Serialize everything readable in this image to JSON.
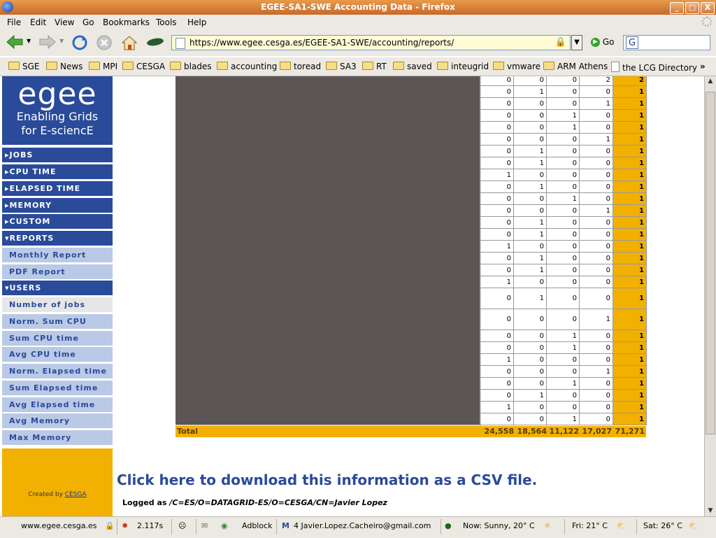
{
  "window": {
    "title": "EGEE-SA1-SWE Accounting Data - Firefox",
    "minimize": "_",
    "maximize": "□",
    "close": "X"
  },
  "menubar": {
    "items": [
      "File",
      "Edit",
      "View",
      "Go",
      "Bookmarks",
      "Tools",
      "Help"
    ]
  },
  "toolbar": {
    "url": "https://www.egee.cesga.es/EGEE-SA1-SWE/accounting/reports/",
    "go_label": "Go",
    "search_engine_glyph": "G"
  },
  "bookmarks": [
    {
      "label": "SGE",
      "type": "folder"
    },
    {
      "label": "News",
      "type": "folder"
    },
    {
      "label": "MPI",
      "type": "folder"
    },
    {
      "label": "CESGA",
      "type": "folder"
    },
    {
      "label": "blades",
      "type": "folder"
    },
    {
      "label": "accounting",
      "type": "folder"
    },
    {
      "label": "toread",
      "type": "folder"
    },
    {
      "label": "SA3",
      "type": "folder"
    },
    {
      "label": "RT",
      "type": "folder"
    },
    {
      "label": "saved",
      "type": "folder"
    },
    {
      "label": "inteugrid",
      "type": "folder"
    },
    {
      "label": "vmware",
      "type": "folder"
    },
    {
      "label": "ARM Athens",
      "type": "folder"
    },
    {
      "label": "the LCG Directory",
      "type": "page"
    }
  ],
  "bookmarks_overflow": "»",
  "logo": {
    "wordmark": "egee",
    "line1": "Enabling Grids",
    "line2": "for E-sciencE"
  },
  "sidebar": {
    "sections": [
      {
        "label": "JOBS",
        "expanded": false
      },
      {
        "label": "CPU TIME",
        "expanded": false
      },
      {
        "label": "ELAPSED TIME",
        "expanded": false
      },
      {
        "label": "MEMORY",
        "expanded": false
      },
      {
        "label": "CUSTOM",
        "expanded": false
      },
      {
        "label": "REPORTS",
        "expanded": true
      },
      {
        "label": "USERS",
        "expanded": true
      }
    ],
    "reports_items": [
      "Monthly Report",
      "PDF Report"
    ],
    "users_items": [
      "Number of jobs",
      "Norm. Sum CPU",
      "Sum CPU time",
      "Avg CPU time",
      "Norm. Elapsed time",
      "Sum Elapsed time",
      "Avg Elapsed time",
      "Avg Memory",
      "Max Memory"
    ],
    "active_item": "Number of jobs",
    "created_by": "Created by",
    "created_by_link": "CESGA"
  },
  "table": {
    "rows": [
      [
        0,
        0,
        0,
        2,
        2
      ],
      [
        0,
        1,
        0,
        0,
        1
      ],
      [
        0,
        0,
        0,
        1,
        1
      ],
      [
        0,
        0,
        1,
        0,
        1
      ],
      [
        0,
        0,
        1,
        0,
        1
      ],
      [
        0,
        0,
        0,
        1,
        1
      ],
      [
        0,
        1,
        0,
        0,
        1
      ],
      [
        0,
        1,
        0,
        0,
        1
      ],
      [
        1,
        0,
        0,
        0,
        1
      ],
      [
        0,
        1,
        0,
        0,
        1
      ],
      [
        0,
        0,
        1,
        0,
        1
      ],
      [
        0,
        0,
        0,
        1,
        1
      ],
      [
        0,
        1,
        0,
        0,
        1
      ],
      [
        0,
        1,
        0,
        0,
        1
      ],
      [
        1,
        0,
        0,
        0,
        1
      ],
      [
        0,
        1,
        0,
        0,
        1
      ],
      [
        0,
        1,
        0,
        0,
        1
      ],
      [
        1,
        0,
        0,
        0,
        1
      ],
      [
        0,
        1,
        0,
        0,
        1
      ],
      [
        0,
        0,
        0,
        1,
        1
      ],
      [
        0,
        0,
        1,
        0,
        1
      ],
      [
        0,
        0,
        1,
        0,
        1
      ],
      [
        1,
        0,
        0,
        0,
        1
      ],
      [
        0,
        0,
        0,
        1,
        1
      ],
      [
        0,
        0,
        1,
        0,
        1
      ],
      [
        0,
        1,
        0,
        0,
        1
      ],
      [
        1,
        0,
        0,
        0,
        1
      ],
      [
        0,
        0,
        1,
        0,
        1
      ]
    ],
    "tall_rows": [
      18,
      19
    ],
    "total_label": "Total",
    "totals": [
      "24,558",
      "18,564",
      "11,122",
      "17,027",
      "71,271"
    ]
  },
  "csv_link": "Click here to download this information as a CSV file.",
  "logged_as_prefix": "Logged as",
  "logged_as_dn": "/C=ES/O=DATAGRID-ES/O=CESGA/CN=Javier Lopez",
  "statusbar": {
    "host": "www.egee.cesga.es",
    "time": "2.117s",
    "adblock": "Adblock",
    "mail": "4 Javier.Lopez.Cacheiro@gmail.com",
    "now": "Now: Sunny, 20° C",
    "fri": "Fri: 21° C",
    "sat": "Sat: 26° C"
  },
  "colors": {
    "egee_blue": "#2a4a9a",
    "egee_orange": "#f2b000",
    "sub_item_bg": "#b9c9e6"
  }
}
